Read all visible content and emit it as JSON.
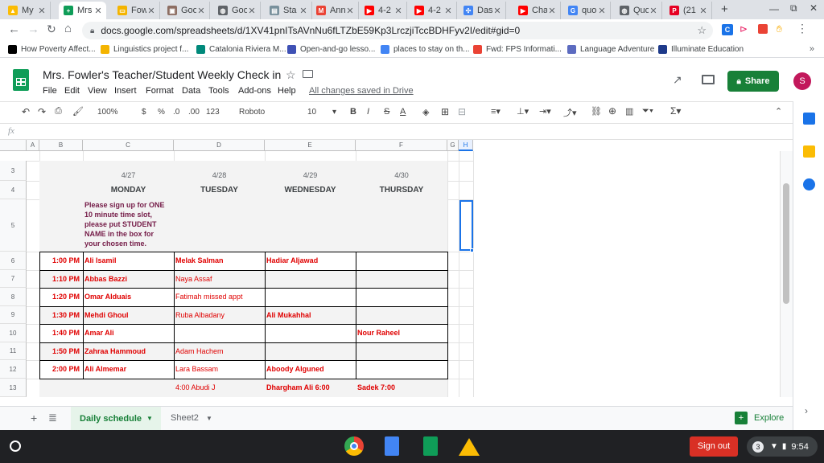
{
  "browser": {
    "tabs": [
      {
        "label": "My",
        "color": "#fbbc04",
        "glyph": "▲"
      },
      {
        "label": "Mrs",
        "color": "#0f9d58",
        "glyph": "+"
      },
      {
        "label": "Fow",
        "color": "#f4b400",
        "glyph": "▭"
      },
      {
        "label": "Goo",
        "color": "#8d6e63",
        "glyph": "▣"
      },
      {
        "label": "Goo",
        "color": "#5f6368",
        "glyph": "◍"
      },
      {
        "label": "Sta",
        "color": "#78909c",
        "glyph": "▤"
      },
      {
        "label": "Ann",
        "color": "#ea4335",
        "glyph": "M"
      },
      {
        "label": "4-2",
        "color": "#ff0000",
        "glyph": "▶"
      },
      {
        "label": "4-2",
        "color": "#ff0000",
        "glyph": "▶"
      },
      {
        "label": "Das",
        "color": "#4285f4",
        "glyph": "✣"
      },
      {
        "label": "Cha",
        "color": "#ff0000",
        "glyph": "▶"
      },
      {
        "label": "quo",
        "color": "#4285f4",
        "glyph": "G"
      },
      {
        "label": "Quo",
        "color": "#5f6368",
        "glyph": "◍"
      },
      {
        "label": "(21",
        "color": "#e60023",
        "glyph": "P"
      }
    ],
    "url": "docs.google.com/spreadsheets/d/1XV41pnITsAVnNu6fLTZbE59Kp3LrczjiTccBDHFyv2I/edit#gid=0",
    "bookmarks": [
      {
        "label": "How Poverty Affect...",
        "color": "#000000"
      },
      {
        "label": "Linguistics project f...",
        "color": "#f4b400"
      },
      {
        "label": "Catalonia Riviera M...",
        "color": "#00897b"
      },
      {
        "label": "Open-and-go lesso...",
        "color": "#3f51b5"
      },
      {
        "label": "places to stay on th...",
        "color": "#4285f4"
      },
      {
        "label": "Fwd: FPS Informati...",
        "color": "#ea4335"
      },
      {
        "label": "Language Adventure",
        "color": "#5c6bc0"
      },
      {
        "label": "Illuminate Education",
        "color": "#1e3a8a"
      }
    ]
  },
  "sheets": {
    "title": "Mrs. Fowler's Teacher/Student Weekly Check in",
    "menu": [
      "File",
      "Edit",
      "View",
      "Insert",
      "Format",
      "Data",
      "Tools",
      "Add-ons",
      "Help"
    ],
    "saved_status": "All changes saved in Drive",
    "share_label": "Share",
    "avatar_letter": "S",
    "toolbar": {
      "zoom": "100%",
      "currency": "$",
      "percent": "%",
      "dec_less": ".0",
      "dec_more": ".00",
      "more_formats": "123",
      "font": "Roboto",
      "font_size": "10",
      "bold": "B",
      "italic": "I",
      "strike": "S",
      "textcolor": "A"
    },
    "fx_label": "fx",
    "columns": [
      "A",
      "B",
      "C",
      "D",
      "E",
      "F",
      "G",
      "H"
    ],
    "rows": [
      "3",
      "4",
      "5",
      "6",
      "7",
      "8",
      "9",
      "10",
      "11",
      "12",
      "13"
    ],
    "dates": [
      "4/27",
      "4/28",
      "4/29",
      "4/30"
    ],
    "days": [
      "MONDAY",
      "TUESDAY",
      "WEDNESDAY",
      "THURSDAY"
    ],
    "instructions": [
      "Please sign up for ONE",
      "10 minute time slot,",
      "please put STUDENT",
      "NAME in the box for",
      "your chosen time."
    ],
    "schedule": [
      {
        "time": "1:00 PM",
        "mon": "Ali Isamil",
        "tue": "Melak Salman",
        "wed": "Hadiar Aljawad",
        "thu": ""
      },
      {
        "time": "1:10 PM",
        "mon": "Abbas Bazzi",
        "tue": "Naya Assaf",
        "wed": "",
        "thu": ""
      },
      {
        "time": "1:20 PM",
        "mon": "Omar Alduais",
        "tue": "Fatimah missed appt",
        "wed": "",
        "thu": ""
      },
      {
        "time": "1:30 PM",
        "mon": "Mehdi Ghoul",
        "tue": "Ruba Albadany",
        "wed": "Ali Mukahhal",
        "thu": ""
      },
      {
        "time": "1:40 PM",
        "mon": "Amar Ali",
        "tue": "",
        "wed": "",
        "thu": "Nour Raheel"
      },
      {
        "time": "1:50 PM",
        "mon": "Zahraa Hammoud",
        "tue": "Adam Hachem",
        "wed": "",
        "thu": ""
      },
      {
        "time": "2:00 PM",
        "mon": "Ali Almemar",
        "tue": "Lara Bassam",
        "wed": "Aboody Alguned",
        "thu": ""
      }
    ],
    "extra_row": {
      "tue": "4:00 Abudi J",
      "wed": "Dhargham Ali 6:00",
      "thu": "Sadek 7:00"
    },
    "sheet_tabs": [
      "Daily schedule",
      "Sheet2"
    ],
    "explore_label": "Explore"
  },
  "shelf": {
    "signout_label": "Sign out",
    "notif_count": "3",
    "clock": "9:54"
  },
  "colors": {
    "accent_green": "#188038",
    "red_text": "#e00000",
    "purple_text": "#741b47",
    "signout_red": "#d93025"
  }
}
